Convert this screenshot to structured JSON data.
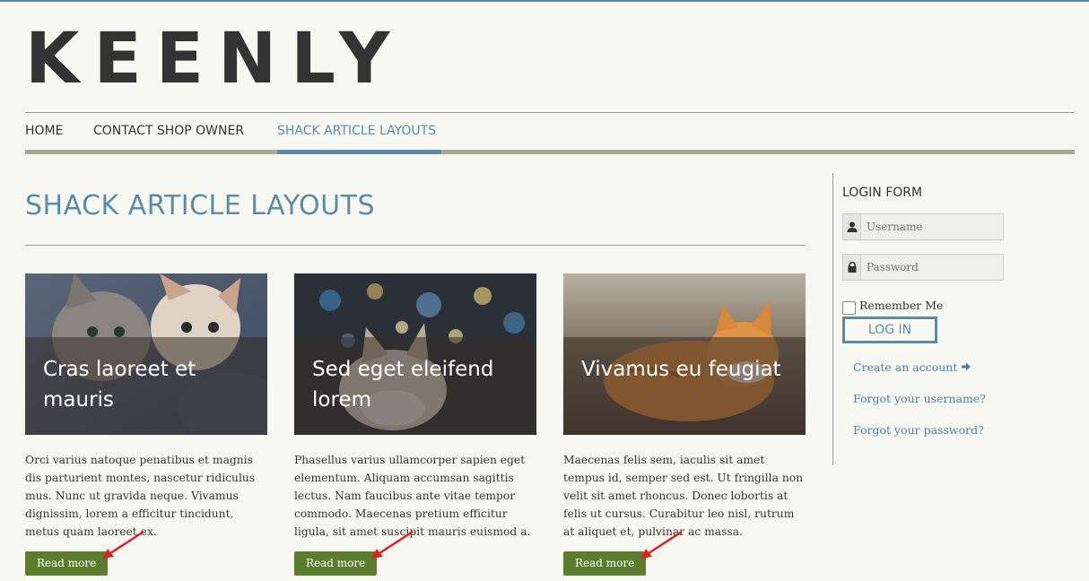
{
  "brand": {
    "logo_text": "KEENLY"
  },
  "nav": {
    "items": [
      {
        "label": "HOME"
      },
      {
        "label": "CONTACT SHOP OWNER"
      },
      {
        "label": "SHACK ARTICLE LAYOUTS"
      }
    ],
    "active_index": 2
  },
  "page": {
    "title": "SHACK ARTICLE LAYOUTS"
  },
  "articles": [
    {
      "title": "Cras laoreet et mauris",
      "image": "kittens-photo",
      "text": "Orci varius natoque penatibus et magnis dis parturient montes, nascetur ridiculus mus. Nunc ut gravida neque. Vivamus dignissim, lorem a efficitur tincidunt, metus quam laoreet ex.",
      "button": "Read more"
    },
    {
      "title": "Sed eget eleifend lorem",
      "image": "cat-bokeh-lights-photo",
      "text": "Phasellus varius ullamcorper sapien eget elementum. Aliquam accumsan sagittis lectus. Nam faucibus ante vitae tempor commodo. Maecenas pretium efficitur ligula, sit amet suscipit mauris euismod a.",
      "button": "Read more"
    },
    {
      "title": "Vivamus eu feugiat",
      "image": "ginger-cat-photo",
      "text": "Maecenas felis sem, iaculis sit amet tempus id, semper sed est. Ut fringilla non velit sit amet rhoncus. Donec lobortis at felis ut cursus. Curabitur leo nisl, rutrum at aliquet et, pulvinar ac massa.",
      "button": "Read more"
    }
  ],
  "login": {
    "heading": "LOGIN FORM",
    "username_placeholder": "Username",
    "password_placeholder": "Password",
    "remember_label": "Remember Me",
    "login_button": "LOG IN",
    "links": {
      "create_account": "Create an account",
      "forgot_username": "Forgot your username?",
      "forgot_password": "Forgot your password?"
    }
  },
  "colors": {
    "accent": "#5b8ba8",
    "button_green": "#5b7d2e",
    "annotation_arrow": "#e02020"
  }
}
